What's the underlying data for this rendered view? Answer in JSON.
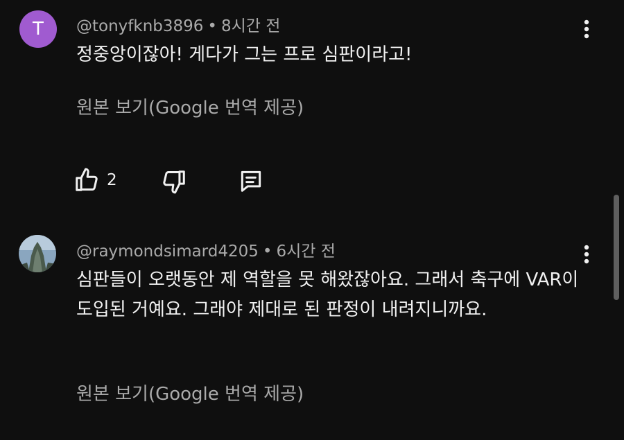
{
  "comments": [
    {
      "avatar_letter": "T",
      "author": "@tonyfknb3896",
      "separator": "•",
      "time": "8시간 전",
      "text": "정중앙이잖아! 게다가 그는 프로 심판이라고!",
      "translate_link": "원본 보기(Google 번역 제공)",
      "like_count": "2",
      "avatar_color": "#a05bd0"
    },
    {
      "author": "@raymondsimard4205",
      "separator": "•",
      "time": "6시간 전",
      "text": "심판들이 오랫동안 제 역할을 못 해왔잖아요. 그래서 축구에 VAR이 도입된 거예요. 그래야 제대로 된 판정이 내려지니까요.",
      "translate_link": "원본 보기(Google 번역 제공)"
    }
  ],
  "icons": {
    "like": "thumbs-up-icon",
    "dislike": "thumbs-down-icon",
    "reply": "comment-reply-icon",
    "more": "more-vertical-icon"
  },
  "colors": {
    "background": "#0f0f0f",
    "primary_text": "#f1f1f1",
    "secondary_text": "#aaaaaa",
    "scrollbar": "#5f5f5f"
  }
}
